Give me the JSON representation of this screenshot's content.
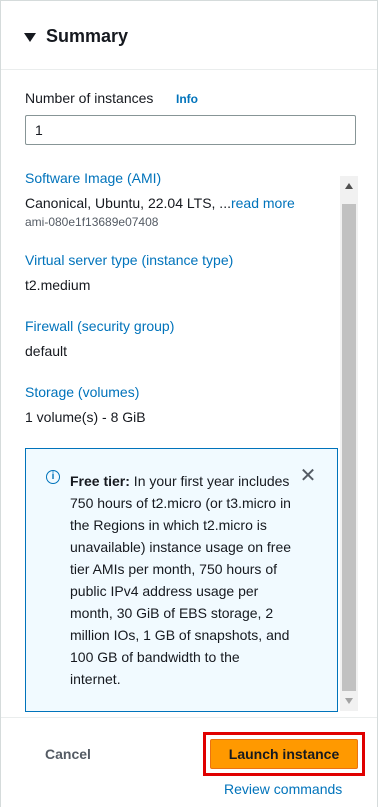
{
  "summary": {
    "title": "Summary"
  },
  "instances": {
    "label": "Number of instances",
    "info": "Info",
    "value": "1"
  },
  "ami": {
    "title": "Software Image (AMI)",
    "value": "Canonical, Ubuntu, 22.04 LTS, ...",
    "read_more": "read more",
    "id": "ami-080e1f13689e07408"
  },
  "instance_type": {
    "title": "Virtual server type (instance type)",
    "value": "t2.medium"
  },
  "firewall": {
    "title": "Firewall (security group)",
    "value": "default"
  },
  "storage": {
    "title": "Storage (volumes)",
    "value": "1 volume(s) - 8 GiB"
  },
  "free_tier": {
    "heading": "Free tier:",
    "body": " In your first year includes 750 hours of t2.micro (or t3.micro in the Regions in which t2.micro is unavailable) instance usage on free tier AMIs per month, 750 hours of public IPv4 address usage per month, 30 GiB of EBS storage, 2 million IOs, 1 GB of snapshots, and 100 GB of bandwidth to the internet."
  },
  "footer": {
    "cancel": "Cancel",
    "launch": "Launch instance",
    "review": "Review commands"
  },
  "colors": {
    "link": "#0073bb",
    "primary_button": "#ff9900",
    "highlight_outline": "#e00000",
    "alert_bg": "#f1faff"
  }
}
